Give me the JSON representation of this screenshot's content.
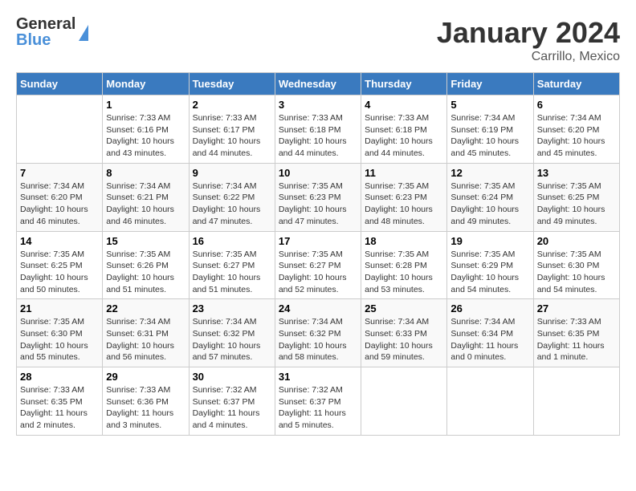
{
  "header": {
    "logo": {
      "general": "General",
      "blue": "Blue"
    },
    "title": "January 2024",
    "location": "Carrillo, Mexico"
  },
  "weekdays": [
    "Sunday",
    "Monday",
    "Tuesday",
    "Wednesday",
    "Thursday",
    "Friday",
    "Saturday"
  ],
  "weeks": [
    [
      {
        "day": "",
        "info": ""
      },
      {
        "day": "1",
        "info": "Sunrise: 7:33 AM\nSunset: 6:16 PM\nDaylight: 10 hours\nand 43 minutes."
      },
      {
        "day": "2",
        "info": "Sunrise: 7:33 AM\nSunset: 6:17 PM\nDaylight: 10 hours\nand 44 minutes."
      },
      {
        "day": "3",
        "info": "Sunrise: 7:33 AM\nSunset: 6:18 PM\nDaylight: 10 hours\nand 44 minutes."
      },
      {
        "day": "4",
        "info": "Sunrise: 7:33 AM\nSunset: 6:18 PM\nDaylight: 10 hours\nand 44 minutes."
      },
      {
        "day": "5",
        "info": "Sunrise: 7:34 AM\nSunset: 6:19 PM\nDaylight: 10 hours\nand 45 minutes."
      },
      {
        "day": "6",
        "info": "Sunrise: 7:34 AM\nSunset: 6:20 PM\nDaylight: 10 hours\nand 45 minutes."
      }
    ],
    [
      {
        "day": "7",
        "info": "Sunrise: 7:34 AM\nSunset: 6:20 PM\nDaylight: 10 hours\nand 46 minutes."
      },
      {
        "day": "8",
        "info": "Sunrise: 7:34 AM\nSunset: 6:21 PM\nDaylight: 10 hours\nand 46 minutes."
      },
      {
        "day": "9",
        "info": "Sunrise: 7:34 AM\nSunset: 6:22 PM\nDaylight: 10 hours\nand 47 minutes."
      },
      {
        "day": "10",
        "info": "Sunrise: 7:35 AM\nSunset: 6:23 PM\nDaylight: 10 hours\nand 47 minutes."
      },
      {
        "day": "11",
        "info": "Sunrise: 7:35 AM\nSunset: 6:23 PM\nDaylight: 10 hours\nand 48 minutes."
      },
      {
        "day": "12",
        "info": "Sunrise: 7:35 AM\nSunset: 6:24 PM\nDaylight: 10 hours\nand 49 minutes."
      },
      {
        "day": "13",
        "info": "Sunrise: 7:35 AM\nSunset: 6:25 PM\nDaylight: 10 hours\nand 49 minutes."
      }
    ],
    [
      {
        "day": "14",
        "info": "Sunrise: 7:35 AM\nSunset: 6:25 PM\nDaylight: 10 hours\nand 50 minutes."
      },
      {
        "day": "15",
        "info": "Sunrise: 7:35 AM\nSunset: 6:26 PM\nDaylight: 10 hours\nand 51 minutes."
      },
      {
        "day": "16",
        "info": "Sunrise: 7:35 AM\nSunset: 6:27 PM\nDaylight: 10 hours\nand 51 minutes."
      },
      {
        "day": "17",
        "info": "Sunrise: 7:35 AM\nSunset: 6:27 PM\nDaylight: 10 hours\nand 52 minutes."
      },
      {
        "day": "18",
        "info": "Sunrise: 7:35 AM\nSunset: 6:28 PM\nDaylight: 10 hours\nand 53 minutes."
      },
      {
        "day": "19",
        "info": "Sunrise: 7:35 AM\nSunset: 6:29 PM\nDaylight: 10 hours\nand 54 minutes."
      },
      {
        "day": "20",
        "info": "Sunrise: 7:35 AM\nSunset: 6:30 PM\nDaylight: 10 hours\nand 54 minutes."
      }
    ],
    [
      {
        "day": "21",
        "info": "Sunrise: 7:35 AM\nSunset: 6:30 PM\nDaylight: 10 hours\nand 55 minutes."
      },
      {
        "day": "22",
        "info": "Sunrise: 7:34 AM\nSunset: 6:31 PM\nDaylight: 10 hours\nand 56 minutes."
      },
      {
        "day": "23",
        "info": "Sunrise: 7:34 AM\nSunset: 6:32 PM\nDaylight: 10 hours\nand 57 minutes."
      },
      {
        "day": "24",
        "info": "Sunrise: 7:34 AM\nSunset: 6:32 PM\nDaylight: 10 hours\nand 58 minutes."
      },
      {
        "day": "25",
        "info": "Sunrise: 7:34 AM\nSunset: 6:33 PM\nDaylight: 10 hours\nand 59 minutes."
      },
      {
        "day": "26",
        "info": "Sunrise: 7:34 AM\nSunset: 6:34 PM\nDaylight: 11 hours\nand 0 minutes."
      },
      {
        "day": "27",
        "info": "Sunrise: 7:33 AM\nSunset: 6:35 PM\nDaylight: 11 hours\nand 1 minute."
      }
    ],
    [
      {
        "day": "28",
        "info": "Sunrise: 7:33 AM\nSunset: 6:35 PM\nDaylight: 11 hours\nand 2 minutes."
      },
      {
        "day": "29",
        "info": "Sunrise: 7:33 AM\nSunset: 6:36 PM\nDaylight: 11 hours\nand 3 minutes."
      },
      {
        "day": "30",
        "info": "Sunrise: 7:32 AM\nSunset: 6:37 PM\nDaylight: 11 hours\nand 4 minutes."
      },
      {
        "day": "31",
        "info": "Sunrise: 7:32 AM\nSunset: 6:37 PM\nDaylight: 11 hours\nand 5 minutes."
      },
      {
        "day": "",
        "info": ""
      },
      {
        "day": "",
        "info": ""
      },
      {
        "day": "",
        "info": ""
      }
    ]
  ]
}
